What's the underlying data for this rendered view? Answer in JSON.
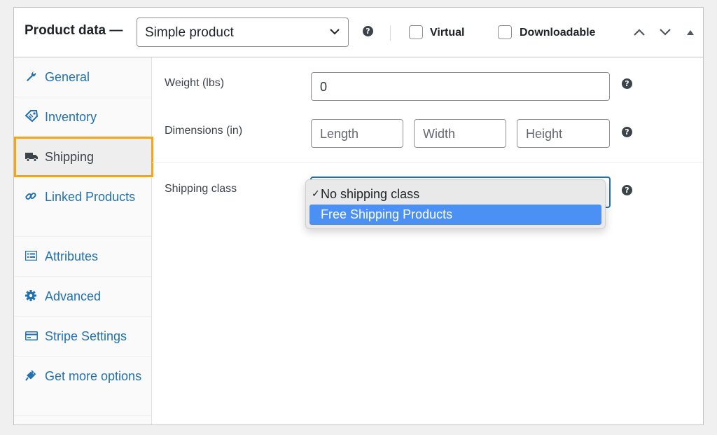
{
  "header": {
    "title": "Product data —",
    "product_type": "Simple product",
    "virtual_label": "Virtual",
    "downloadable_label": "Downloadable"
  },
  "sidebar": {
    "items": [
      {
        "label": "General",
        "icon": "wrench-icon"
      },
      {
        "label": "Inventory",
        "icon": "tag-icon"
      },
      {
        "label": "Shipping",
        "icon": "truck-icon",
        "active": true
      },
      {
        "label": "Linked Products",
        "icon": "link-icon"
      },
      {
        "label": "Attributes",
        "icon": "list-icon"
      },
      {
        "label": "Advanced",
        "icon": "gear-icon"
      },
      {
        "label": "Stripe Settings",
        "icon": "card-icon"
      },
      {
        "label": "Get more options",
        "icon": "plug-icon"
      }
    ]
  },
  "shipping": {
    "weight_label": "Weight (lbs)",
    "weight_value": "0",
    "dimensions_label": "Dimensions (in)",
    "length_placeholder": "Length",
    "width_placeholder": "Width",
    "height_placeholder": "Height",
    "class_label": "Shipping class",
    "class_options": [
      {
        "label": "No shipping class",
        "checked": true
      },
      {
        "label": "Free Shipping Products",
        "highlighted": true
      }
    ]
  },
  "colors": {
    "link": "#2271b1",
    "highlight_border": "#f6a517",
    "option_highlight": "#4a90f5"
  }
}
